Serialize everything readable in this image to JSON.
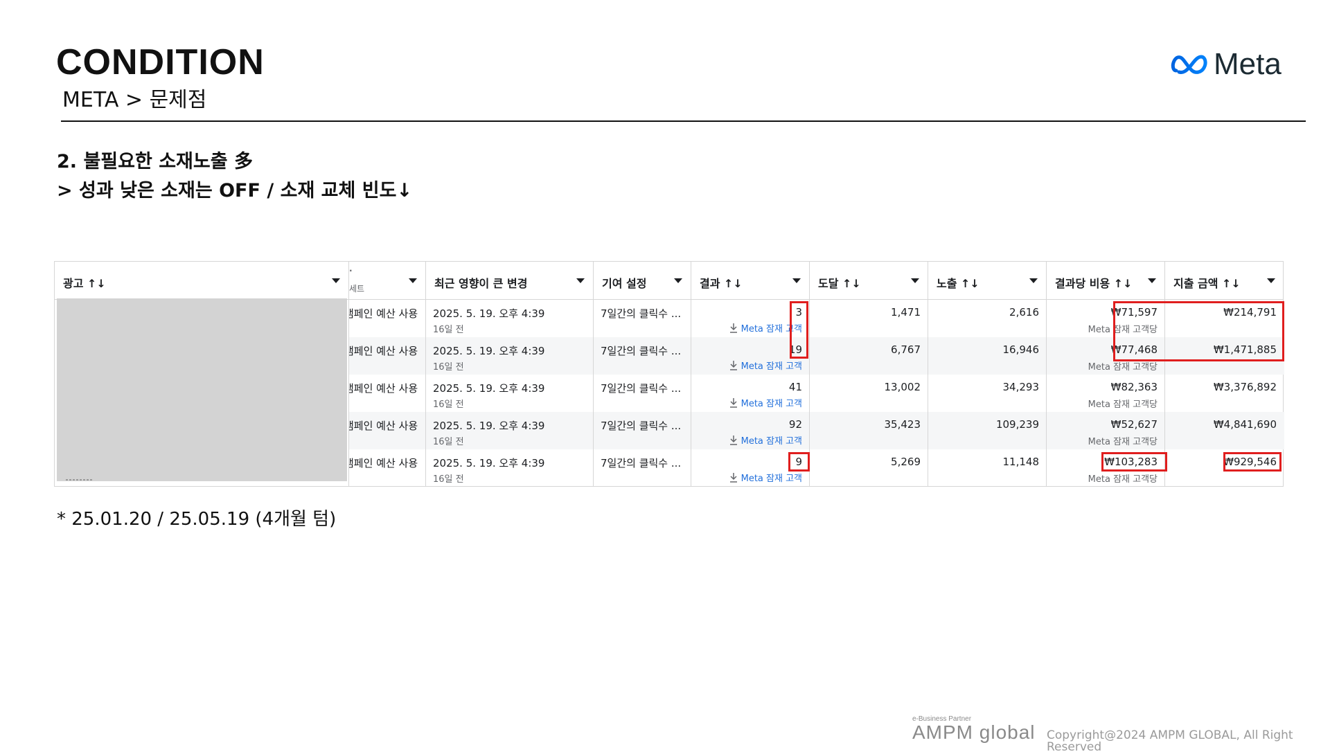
{
  "header": {
    "title": "CONDITION",
    "breadcrumb": "META > 문제점",
    "logo_text": "Meta",
    "logo_icon": "meta-infinity-logo"
  },
  "content": {
    "heading": "2. 불필요한 소재노출 多",
    "subheading": "> 성과 낮은 소재는 OFF / 소재 교체 빈도↓"
  },
  "table": {
    "columns": {
      "ad": "광고 ↑↓",
      "adset_sub": "세트",
      "recent_change": "최근 영향이 큰 변경",
      "attribution": "기여 설정",
      "results": "결과 ↑↓",
      "reach": "도달 ↑↓",
      "impressions": "노출 ↑↓",
      "cost_per_result": "결과당 비용 ↑↓",
      "amount_spent": "지출 금액 ↑↓"
    },
    "rows": [
      {
        "budget": "캠페인 예산 사용",
        "change_date": "2025. 5. 19. 오후 4:39",
        "change_ago": "16일 전",
        "attribution": "7일간의 클릭수 ...",
        "results": "3",
        "results_sub": "Meta 잠재 고객",
        "reach": "1,471",
        "impressions": "2,616",
        "cpr": "₩71,597",
        "cpr_sub": "Meta 잠재 고객당",
        "spent": "₩214,791"
      },
      {
        "budget": "캠페인 예산 사용",
        "change_date": "2025. 5. 19. 오후 4:39",
        "change_ago": "16일 전",
        "attribution": "7일간의 클릭수 ...",
        "results": "19",
        "results_sub": "Meta 잠재 고객",
        "reach": "6,767",
        "impressions": "16,946",
        "cpr": "₩77,468",
        "cpr_sub": "Meta 잠재 고객당",
        "spent": "₩1,471,885"
      },
      {
        "budget": "캠페인 예산 사용",
        "change_date": "2025. 5. 19. 오후 4:39",
        "change_ago": "16일 전",
        "attribution": "7일간의 클릭수 ...",
        "results": "41",
        "results_sub": "Meta 잠재 고객",
        "reach": "13,002",
        "impressions": "34,293",
        "cpr": "₩82,363",
        "cpr_sub": "Meta 잠재 고객당",
        "spent": "₩3,376,892"
      },
      {
        "budget": "캠페인 예산 사용",
        "change_date": "2025. 5. 19. 오후 4:39",
        "change_ago": "16일 전",
        "attribution": "7일간의 클릭수 ...",
        "results": "92",
        "results_sub": "Meta 잠재 고객",
        "reach": "35,423",
        "impressions": "109,239",
        "cpr": "₩52,627",
        "cpr_sub": "Meta 잠재 고객당",
        "spent": "₩4,841,690"
      },
      {
        "budget": "캠페인 예산 사용",
        "change_date": "2025. 5. 19. 오후 4:39",
        "change_ago": "16일 전",
        "attribution": "7일간의 클릭수 ...",
        "results": "9",
        "results_sub": "Meta 잠재 고객",
        "reach": "5,269",
        "impressions": "11,148",
        "cpr": "₩103,283",
        "cpr_sub": "Meta 잠재 고객당",
        "spent": "₩929,546"
      }
    ]
  },
  "footnote": "* 25.01.20 / 25.05.19 (4개월 텀)",
  "footer": {
    "partner_label": "e-Business Partner",
    "brand": "AMPM global",
    "copyright": "Copyright@2024 AMPM GLOBAL, All Right Reserved"
  },
  "colors": {
    "highlight": "#e01e1e",
    "link": "#216fdb",
    "meta_blue": "#0866ff",
    "redaction": "#d3d3d3"
  }
}
